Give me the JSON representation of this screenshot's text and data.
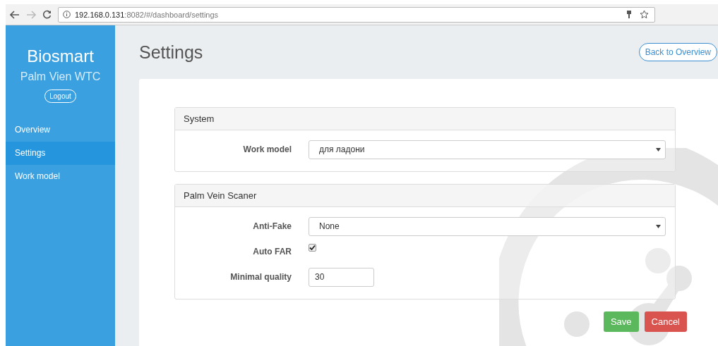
{
  "browser": {
    "url_host": "192.168.0.131",
    "url_rest": ":8082/#/dashboard/settings"
  },
  "sidebar": {
    "brand": "Biosmart",
    "subtitle": "Palm Vien WTC",
    "logout": "Logout",
    "items": [
      {
        "label": "Overview",
        "selected": false
      },
      {
        "label": "Settings",
        "selected": true
      },
      {
        "label": "Work model",
        "selected": false
      }
    ]
  },
  "page": {
    "title": "Settings",
    "back_button": "Back to Overview"
  },
  "panels": [
    {
      "title": "System",
      "fields": [
        {
          "kind": "select",
          "label": "Work model",
          "value": "для ладони"
        }
      ]
    },
    {
      "title": "Palm Vein Scaner",
      "fields": [
        {
          "kind": "select",
          "label": "Anti-Fake",
          "value": "None"
        },
        {
          "kind": "checkbox",
          "label": "Auto FAR",
          "checked": true
        },
        {
          "kind": "text",
          "label": "Minimal quality",
          "value": "30"
        }
      ]
    }
  ],
  "buttons": {
    "save": "Save",
    "cancel": "Cancel"
  }
}
